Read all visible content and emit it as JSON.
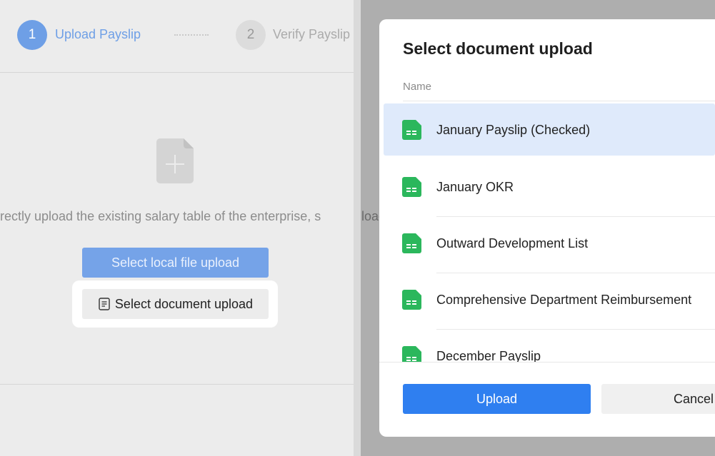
{
  "steps": {
    "step1_number": "1",
    "step1_label": "Upload Payslip",
    "step2_number": "2",
    "step2_label": "Verify Payslip"
  },
  "upload_area": {
    "hint": "irectly upload the existing salary table of the enterprise, s",
    "local_button": "Select local file upload",
    "document_button": "Select document upload"
  },
  "modal": {
    "title": "Select document upload",
    "column_header": "Name",
    "items": [
      {
        "name": "January Payslip (Checked)",
        "selected": true
      },
      {
        "name": "January OKR",
        "selected": false
      },
      {
        "name": "Outward Development List",
        "selected": false
      },
      {
        "name": "Comprehensive Department Reimbursement",
        "selected": false
      },
      {
        "name": "December Payslip",
        "selected": false
      }
    ],
    "overflow_text": "load",
    "upload_button": "Upload",
    "cancel_button": "Cancel"
  },
  "colors": {
    "primary": "#2f7ff0",
    "step_active": "#6e9fe6",
    "sheet_icon": "#2bb75c",
    "selected_row": "#dfeafb"
  },
  "icons": {
    "add_file": "add-file-icon",
    "document": "document-icon",
    "sheet": "spreadsheet-icon"
  }
}
